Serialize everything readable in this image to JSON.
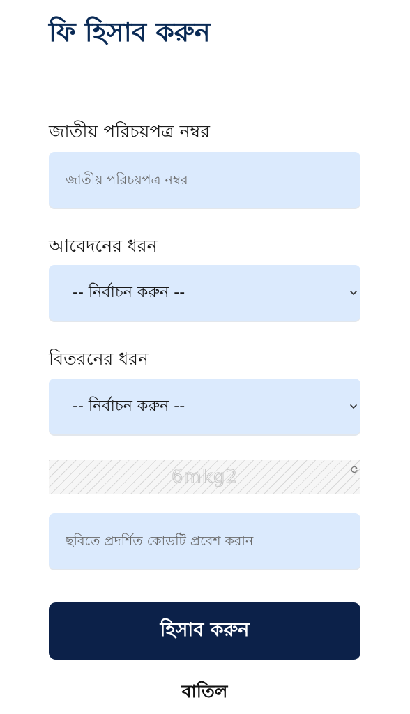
{
  "page": {
    "title": "ফি হিসাব করুন"
  },
  "form": {
    "nid": {
      "label": "জাতীয় পরিচয়পত্র নম্বর",
      "placeholder": "জাতীয় পরিচয়পত্র নম্বর",
      "value": ""
    },
    "application_type": {
      "label": "আবেদনের ধরন",
      "selected": "-- নির্বাচন করুন --"
    },
    "delivery_type": {
      "label": "বিতরনের ধরন",
      "selected": "-- নির্বাচন করুন --"
    },
    "captcha": {
      "text": "6mkg2"
    },
    "captcha_input": {
      "placeholder": "ছবিতে প্রদর্শিত কোডটি প্রবেশ করান",
      "value": ""
    }
  },
  "actions": {
    "submit_label": "হিসাব করুন",
    "cancel_label": "বাতিল"
  },
  "icons": {
    "select_arrow": "chevron-down-icon",
    "captcha_refresh": "refresh-icon"
  },
  "colors": {
    "title": "#0a2a55",
    "field_background": "#dbeafd",
    "primary_button": "#0c2149",
    "primary_button_text": "#ffffff"
  }
}
